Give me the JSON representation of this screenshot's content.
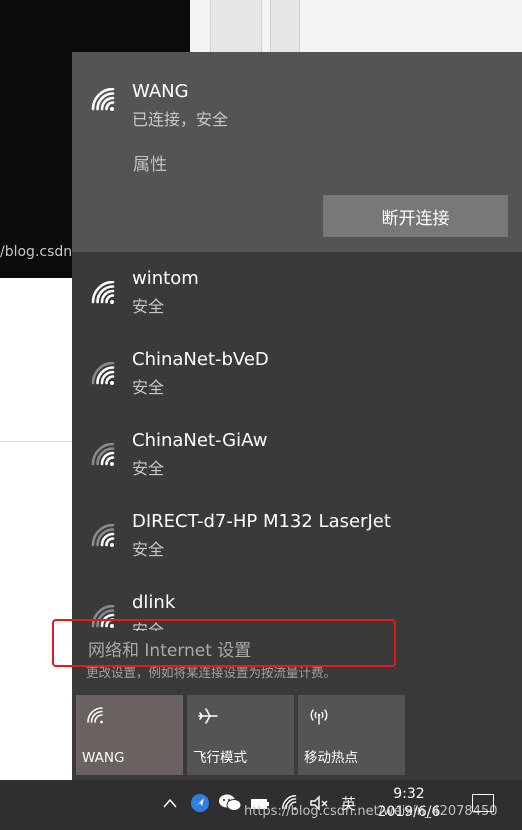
{
  "background": {
    "url_fragment": "/blog.csdn.n"
  },
  "connected_network": {
    "name": "WANG",
    "status": "已连接，安全",
    "properties_label": "属性",
    "disconnect_label": "断开连接"
  },
  "networks": [
    {
      "name": "wintom",
      "security": "安全"
    },
    {
      "name": "ChinaNet-bVeD",
      "security": "安全"
    },
    {
      "name": "ChinaNet-GiAw",
      "security": "安全"
    },
    {
      "name": "DIRECT-d7-HP M132 LaserJet",
      "security": "安全"
    },
    {
      "name": "dlink",
      "security": "安全"
    }
  ],
  "settings": {
    "link": "网络和 Internet 设置",
    "description": "更改设置，例如将某连接设置为按流量计费。"
  },
  "quick_actions": [
    {
      "label": "WANG",
      "icon": "wifi-icon",
      "active": true
    },
    {
      "label": "飞行模式",
      "icon": "airplane-icon",
      "active": false
    },
    {
      "label": "移动热点",
      "icon": "hotspot-icon",
      "active": false
    }
  ],
  "taskbar": {
    "time": "9:32",
    "date": "2019/6/6",
    "ime": "英",
    "watermark": "https://blog.csdn.net/weixin_42078450"
  },
  "colors": {
    "flyout_bg": "#3a3a3a",
    "connected_bg": "#565453",
    "highlight_border": "#e51b1b",
    "taskbar_bg": "#2f2f2f"
  }
}
